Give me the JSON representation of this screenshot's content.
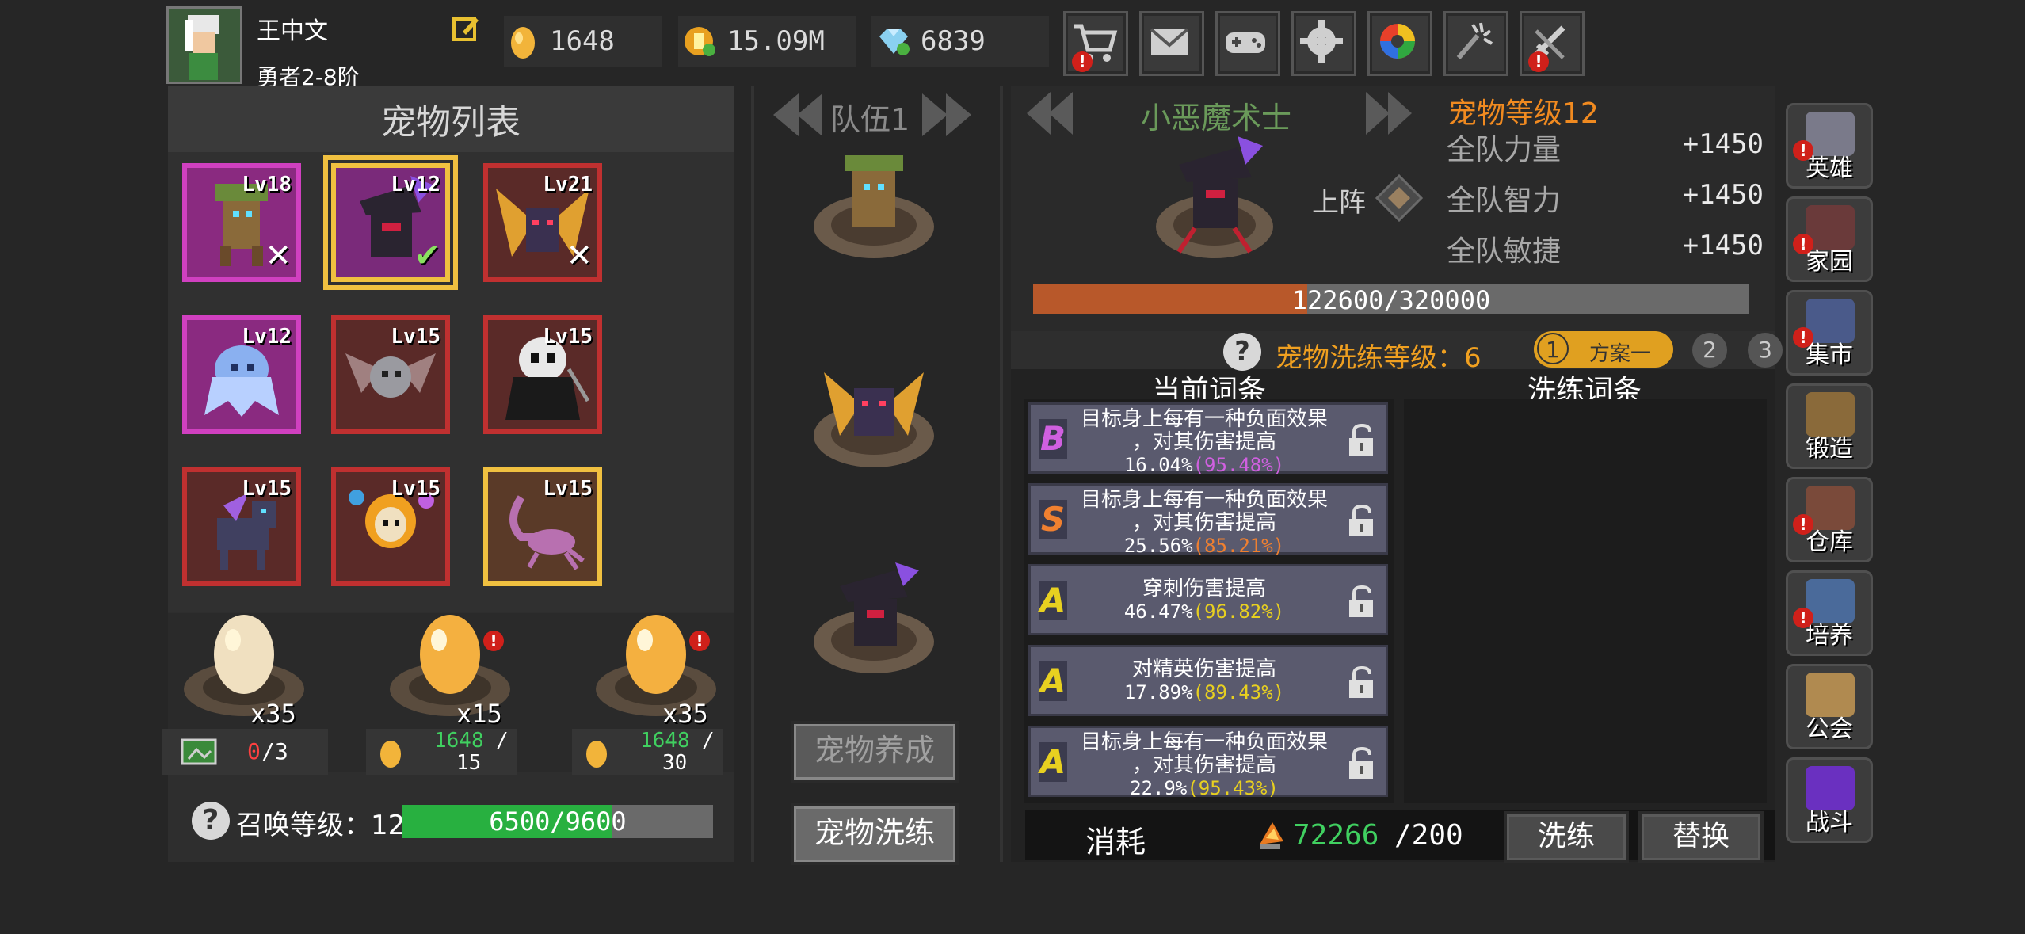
{
  "player": {
    "name": "王中文",
    "rank": "勇者2-8阶"
  },
  "resources": {
    "eggs": "1648",
    "gold": "15.09M",
    "diamonds": "6839"
  },
  "toolbar": {
    "icons": [
      "cart-icon",
      "mail-icon",
      "gamepad-icon",
      "gear-icon",
      "color-wheel-icon",
      "firework-icon",
      "sword-icon"
    ]
  },
  "pet_list": {
    "title": "宠物列表",
    "pets": [
      {
        "lv": "Lv18",
        "name": "treant",
        "frame": "#d040c0",
        "team": true
      },
      {
        "lv": "Lv12",
        "name": "little-imp",
        "frame": "#f0c040",
        "team": true,
        "selected": true
      },
      {
        "lv": "Lv21",
        "name": "fire-bat",
        "frame": "#c03030",
        "team": true
      },
      {
        "lv": "Lv12",
        "name": "ice-ghost",
        "frame": "#d040c0"
      },
      {
        "lv": "Lv15",
        "name": "grey-bat",
        "frame": "#c03030"
      },
      {
        "lv": "Lv15",
        "name": "reaper",
        "frame": "#c03030"
      },
      {
        "lv": "Lv15",
        "name": "purple-pony",
        "frame": "#c03030"
      },
      {
        "lv": "Lv15",
        "name": "flame-skull",
        "frame": "#c03030"
      },
      {
        "lv": "Lv15",
        "name": "scorpion",
        "frame": "#f0c040"
      }
    ]
  },
  "eggs": [
    {
      "count": "x35",
      "cost_a": "0",
      "cost_b": "/3"
    },
    {
      "count": "x15",
      "cost_a": "1648",
      "cost_b": "/",
      "cost_c": "15"
    },
    {
      "count": "x35",
      "cost_a": "1648",
      "cost_b": "/",
      "cost_c": "30"
    }
  ],
  "summon": {
    "label": "召唤等级：12",
    "progress_text": "6500/9600",
    "progress": 0.677
  },
  "team": {
    "label": "队伍1",
    "members": [
      "treant",
      "fire-bat",
      "little-imp"
    ],
    "btn_raise": "宠物养成",
    "btn_refine": "宠物洗练"
  },
  "detail": {
    "pet_name": "小恶魔术士",
    "pet_level": "宠物等级12",
    "deploy": "上阵",
    "attrs": [
      {
        "name": "全队力量",
        "value": "+1450"
      },
      {
        "name": "全队智力",
        "value": "+1450"
      },
      {
        "name": "全队敏捷",
        "value": "+1450"
      }
    ],
    "exp_text": "122600/320000",
    "exp": 0.383
  },
  "refine": {
    "level_label": "宠物洗练等级：6",
    "plans": [
      "1",
      "方案一",
      "2",
      "3"
    ],
    "col_current": "当前词条",
    "col_refine": "洗练词条",
    "entries": [
      {
        "grade": "B",
        "color": "#d060e0",
        "line1": "目标身上每有一种负面效果",
        "line2": "，对其伤害提高",
        "val": "16.04%",
        "max": "(95.48%)"
      },
      {
        "grade": "S",
        "color": "#f08030",
        "line1": "目标身上每有一种负面效果",
        "line2": "，对其伤害提高",
        "val": "25.56%",
        "max": "(85.21%)"
      },
      {
        "grade": "A",
        "color": "#e8d020",
        "line1": "穿刺伤害提高",
        "line2": "",
        "val": "46.47%",
        "max": "(96.82%)"
      },
      {
        "grade": "A",
        "color": "#e8d020",
        "line1": "对精英伤害提高",
        "line2": "",
        "val": "17.89%",
        "max": "(89.43%)"
      },
      {
        "grade": "A",
        "color": "#e8d020",
        "line1": "目标身上每有一种负面效果",
        "line2": "，对其伤害提高",
        "val": "22.9%",
        "max": "(95.43%)"
      }
    ],
    "cost_label": "消耗",
    "cost_have": "72266",
    "cost_need": "/200",
    "btn_refine": "洗练",
    "btn_replace": "替换"
  },
  "sidebar": [
    {
      "label": "英雄",
      "warn": true
    },
    {
      "label": "家园",
      "warn": true
    },
    {
      "label": "集市",
      "warn": true
    },
    {
      "label": "锻造",
      "warn": false
    },
    {
      "label": "仓库",
      "warn": true
    },
    {
      "label": "培养",
      "warn": true
    },
    {
      "label": "公会",
      "warn": false
    },
    {
      "label": "战斗",
      "warn": false
    }
  ]
}
